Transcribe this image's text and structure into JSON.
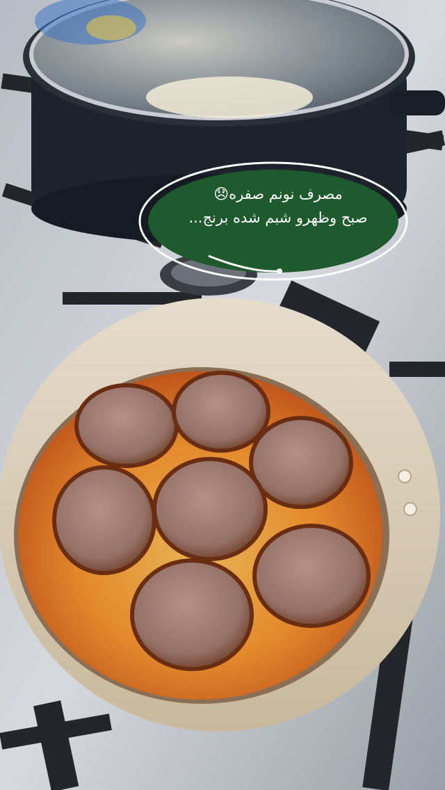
{
  "photo": {
    "description_icon": "cooking-photo",
    "colors": {
      "stove": "#c9ccd1",
      "grate": "#2b2d33",
      "pot": "#1f2430",
      "pan_rim": "#d8c9b2",
      "oil": "#e08a2a",
      "patty": "#9b7a70",
      "bubble": "#1f5a2e"
    }
  },
  "caption": {
    "line1": "مصرف نونم صفره😞",
    "line2": "صبح وظهرو شبم شده برنج..."
  }
}
